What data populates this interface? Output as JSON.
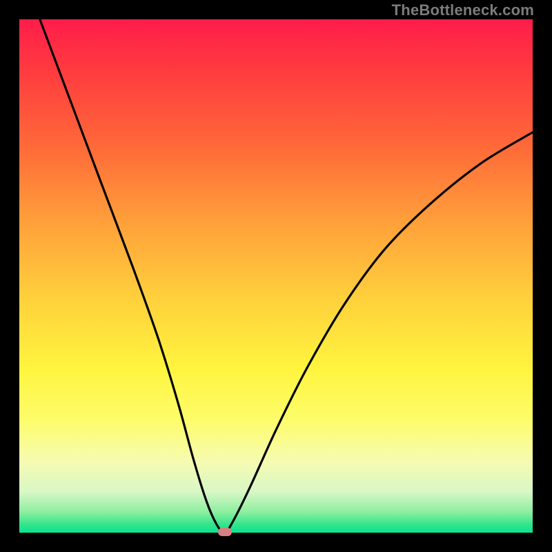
{
  "watermark": "TheBottleneck.com",
  "chart_data": {
    "type": "line",
    "title": "",
    "xlabel": "",
    "ylabel": "",
    "xlim": [
      0,
      100
    ],
    "ylim": [
      0,
      100
    ],
    "series": [
      {
        "name": "bottleneck-curve",
        "x": [
          4,
          10,
          16,
          22,
          27,
          31,
          34,
          36.5,
          38.5,
          40,
          41.5,
          45,
          50,
          56,
          63,
          71,
          80,
          90,
          100
        ],
        "values": [
          100,
          84,
          68,
          52,
          38,
          25,
          14,
          6,
          1.5,
          0,
          2,
          9,
          20,
          32,
          44,
          55,
          64,
          72,
          78
        ]
      }
    ],
    "marker": {
      "x": 40,
      "y": 0
    },
    "background_gradient": {
      "top": "#ff1d4a",
      "mid": "#ffd23c",
      "bottom": "#0be293"
    }
  }
}
